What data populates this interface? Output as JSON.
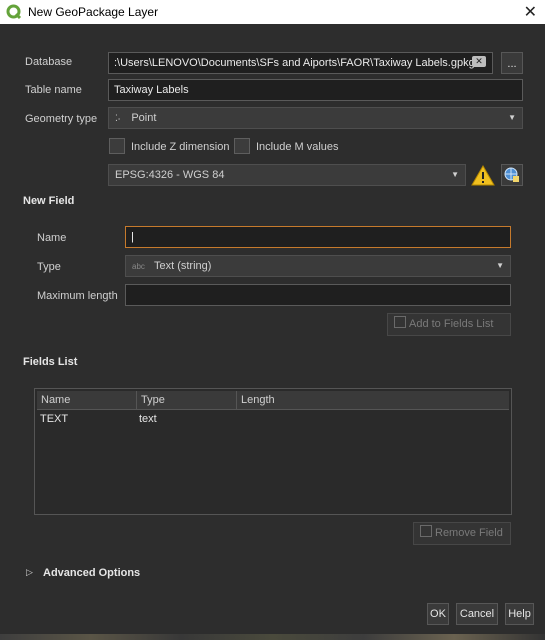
{
  "window": {
    "title": "New GeoPackage Layer"
  },
  "form": {
    "database_label": "Database",
    "database_value": ":\\Users\\LENOVO\\Documents\\SFs and Aiports\\FAOR\\Taxiway Labels.gpkg",
    "browse_label": "...",
    "table_name_label": "Table name",
    "table_name_value": "Taxiway Labels",
    "geometry_type_label": "Geometry type",
    "geometry_type_value": "Point",
    "include_z_label": "Include Z dimension",
    "include_m_label": "Include M values",
    "crs_value": "EPSG:4326 - WGS 84"
  },
  "new_field": {
    "section_label": "New Field",
    "name_label": "Name",
    "name_value": "",
    "type_label": "Type",
    "type_value": "Text (string)",
    "max_length_label": "Maximum length",
    "max_length_value": "",
    "add_button_label": "Add to Fields List"
  },
  "fields_list": {
    "section_label": "Fields List",
    "columns": [
      "Name",
      "Type",
      "Length"
    ],
    "rows": [
      {
        "name": "TEXT",
        "type": "text",
        "length": ""
      }
    ],
    "remove_button_label": "Remove Field"
  },
  "advanced": {
    "label": "Advanced Options"
  },
  "buttons": {
    "ok": "OK",
    "cancel": "Cancel",
    "help": "Help"
  },
  "colors": {
    "qgis_green": "#64a33a",
    "warning_yellow": "#f0c020"
  }
}
